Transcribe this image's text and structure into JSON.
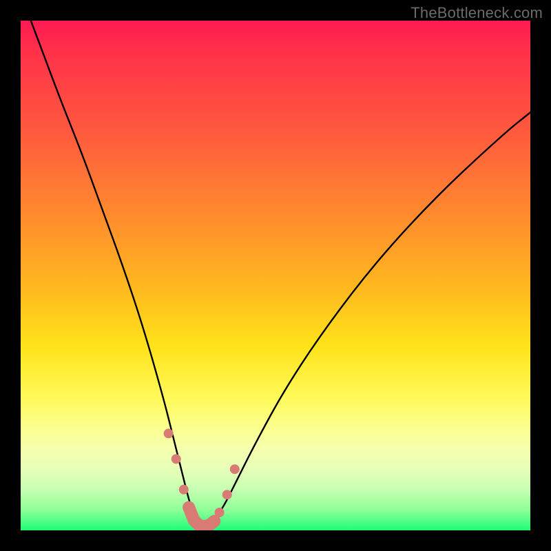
{
  "watermark": "TheBottleneck.com",
  "chart_data": {
    "type": "line",
    "title": "",
    "xlabel": "",
    "ylabel": "",
    "xlim": [
      0,
      100
    ],
    "ylim": [
      0,
      100
    ],
    "series": [
      {
        "name": "bottleneck-curve",
        "x": [
          2,
          5,
          8,
          12,
          16,
          20,
          24,
          28,
          30,
          32,
          33,
          34,
          35,
          36,
          37,
          38,
          40,
          42,
          46,
          52,
          60,
          70,
          82,
          95,
          100
        ],
        "values": [
          100,
          92,
          84,
          74,
          63,
          52,
          40,
          26,
          18,
          10,
          6,
          3,
          1,
          0.5,
          1,
          2,
          5,
          9,
          17,
          28,
          40,
          53,
          66,
          78,
          82
        ]
      },
      {
        "name": "highlight-band",
        "x": [
          29,
          30.5,
          32,
          33,
          34,
          35,
          36,
          37,
          38,
          39,
          40.5,
          42
        ],
        "values": [
          19,
          14,
          8,
          4.5,
          2,
          1,
          0.8,
          1,
          1.8,
          3.5,
          7,
          12
        ]
      }
    ],
    "annotations": {
      "highlight_dot_radius_px": 7,
      "colors": {
        "curve": "#000000",
        "highlight": "#d77b74",
        "gradient_top": "#ff1a52",
        "gradient_bottom": "#1dfd76"
      }
    }
  }
}
